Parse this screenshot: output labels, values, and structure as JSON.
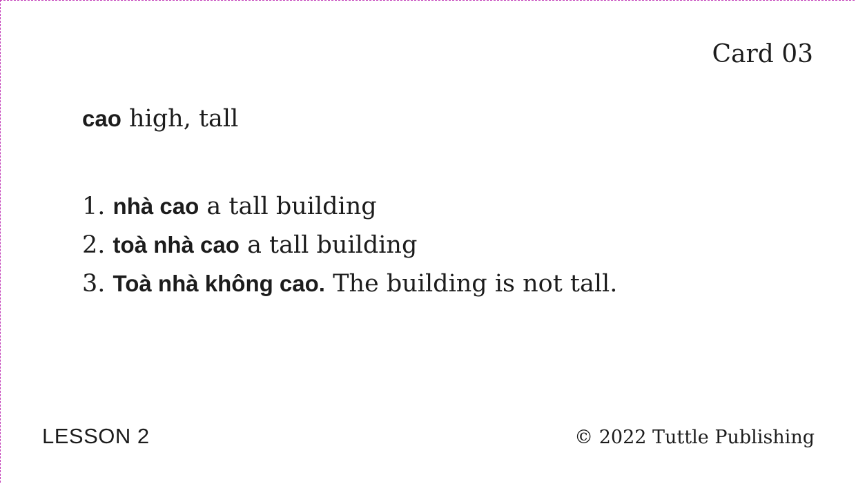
{
  "card": {
    "number": "Card 03",
    "headword": {
      "vietnamese": "cao",
      "english": "high, tall"
    },
    "examples": [
      {
        "index": "1.",
        "vietnamese": "nhà cao",
        "english": "a tall building"
      },
      {
        "index": "2.",
        "vietnamese": "toà nhà cao",
        "english": "a tall building"
      },
      {
        "index": "3.",
        "vietnamese": "Toà nhà không cao.",
        "english": "The building is not tall."
      }
    ],
    "lesson": "LESSON 2",
    "copyright": "© 2022 Tuttle Publishing"
  }
}
